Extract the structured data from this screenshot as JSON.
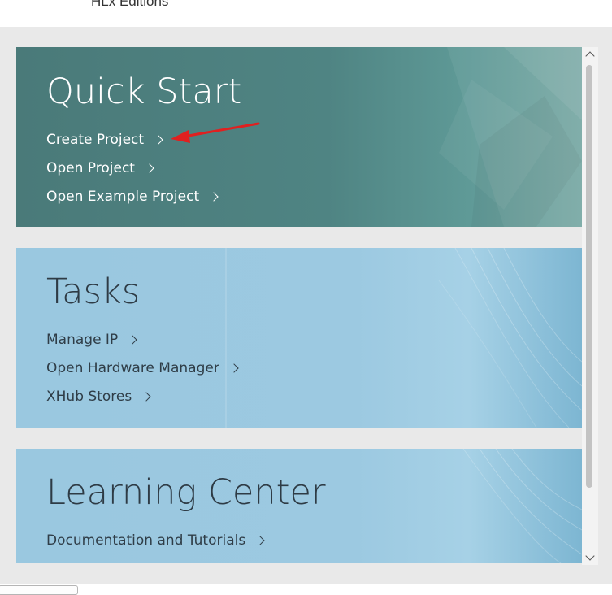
{
  "header": {
    "caption": "HLx Editions"
  },
  "quick_start": {
    "title": "Quick Start",
    "links": [
      "Create Project",
      "Open Project",
      "Open Example Project"
    ]
  },
  "tasks": {
    "title": "Tasks",
    "links": [
      "Manage IP",
      "Open Hardware Manager",
      "XHub Stores"
    ]
  },
  "learning_center": {
    "title": "Learning Center",
    "links": [
      "Documentation and Tutorials"
    ]
  },
  "colors": {
    "quick_start_bg": "#4f8483",
    "tasks_bg": "#9cc9e1",
    "learning_center_bg": "#9cc9e1",
    "annotation_arrow": "#e02020",
    "title_dark": "#2e3b45"
  },
  "icons": {
    "link_chevron": "chevron-right-icon",
    "annotation": "red-arrow-icon",
    "scroll_up": "chevron-up-icon",
    "scroll_down": "chevron-down-icon"
  }
}
